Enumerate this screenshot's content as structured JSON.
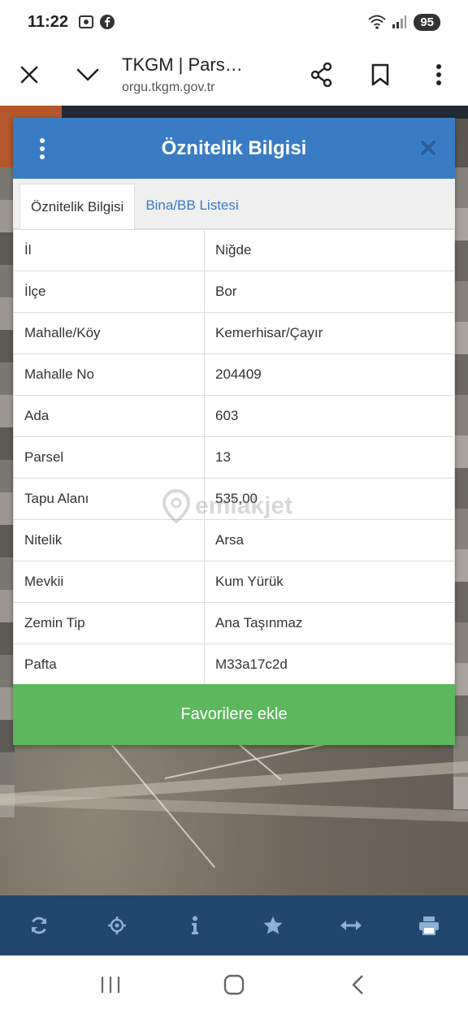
{
  "status_bar": {
    "time": "11:22",
    "battery": "95",
    "icons": [
      "screenshot-icon",
      "facebook-icon",
      "wifi-icon",
      "signal-icon",
      "battery-icon"
    ]
  },
  "browser": {
    "title": "TKGM | Pars…",
    "url": "orgu.tkgm.gov.tr",
    "icons": [
      "close-icon",
      "chevron-down-icon",
      "share-icon",
      "bookmark-icon",
      "more-vert-icon"
    ]
  },
  "modal": {
    "title": "Öznitelik Bilgisi",
    "tabs": [
      "Öznitelik Bilgisi",
      "Bina/BB Listesi"
    ],
    "rows": [
      {
        "key": "İl",
        "value": "Niğde"
      },
      {
        "key": "İlçe",
        "value": "Bor"
      },
      {
        "key": "Mahalle/Köy",
        "value": "Kemerhisar/Çayır"
      },
      {
        "key": "Mahalle No",
        "value": "204409"
      },
      {
        "key": "Ada",
        "value": "603"
      },
      {
        "key": "Parsel",
        "value": "13"
      },
      {
        "key": "Tapu Alanı",
        "value": "535,00"
      },
      {
        "key": "Nitelik",
        "value": "Arsa"
      },
      {
        "key": "Mevkii",
        "value": "Kum Yürük"
      },
      {
        "key": "Zemin Tip",
        "value": "Ana Taşınmaz"
      },
      {
        "key": "Pafta",
        "value": "M33a17c2d"
      }
    ],
    "favorite_button": "Favorilere ekle"
  },
  "watermark": "emlakjet",
  "app_toolbar": {
    "icons": [
      "refresh-icon",
      "crosshair-icon",
      "info-icon",
      "star-icon",
      "measure-icon",
      "print-icon"
    ]
  },
  "nav_bar": {
    "icons": [
      "recent-apps-icon",
      "home-icon",
      "back-icon"
    ]
  },
  "colors": {
    "header_blue": "#3a7cc4",
    "button_green": "#5cb85c",
    "toolbar_navy": "#21476f"
  }
}
